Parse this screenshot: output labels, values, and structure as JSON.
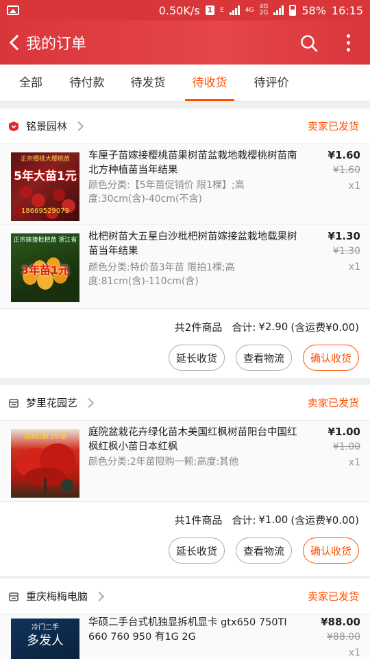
{
  "status_bar": {
    "speed": "0.50K/s",
    "sim": "1",
    "network_a": "E",
    "network_b": "4G",
    "network_c_top": "4G",
    "network_c_bottom": "2G",
    "battery": "58%",
    "time": "16:15"
  },
  "header": {
    "title": "我的订单"
  },
  "tabs": [
    {
      "label": "全部",
      "active": false
    },
    {
      "label": "待付款",
      "active": false
    },
    {
      "label": "待发货",
      "active": false
    },
    {
      "label": "待收货",
      "active": true
    },
    {
      "label": "待评价",
      "active": false
    }
  ],
  "orders": [
    {
      "shop": "铭景园林",
      "status": "卖家已发货",
      "items": [
        {
          "title": "车厘子苗嫁接樱桃苗果树苗盆栽地栽樱桃树苗南北方种植苗当年结果",
          "spec": "颜色分类:【5年苗促销价 限1棵】;高度:30cm(含)-40cm(不含)",
          "price": "¥1.60",
          "original_price": "¥1.60",
          "qty": "x1",
          "thumb_text_top": "正宗樱桃大樱桃苗",
          "thumb_text_mid": "5年大苗1元",
          "thumb_text_bottom": "18669529079"
        },
        {
          "title": "枇杷树苗大五星白沙枇杷树苗嫁接盆栽地载果树苗当年结果",
          "spec": "颜色分类:特价苗3年苗 限拍1棵;高度:81cm(含)-110cm(含)",
          "price": "¥1.30",
          "original_price": "¥1.30",
          "qty": "x1",
          "thumb_text_top": "正宗嫁接枇杷苗 浙江省",
          "thumb_text_mid": "3年苗1元"
        }
      ],
      "summary_count": "共2件商品",
      "summary_total_label": "合计:",
      "summary_total": "¥2.90",
      "summary_shipping": "(含运费¥0.00)",
      "buttons": [
        "延长收货",
        "查看物流",
        "确认收货"
      ]
    },
    {
      "shop": "梦里花园艺",
      "status": "卖家已发货",
      "items": [
        {
          "title": "庭院盆栽花卉绿化苗木美国红枫树苗阳台中国红枫红枫小苗日本红枫",
          "spec": "颜色分类:2年苗限购一颗;高度:其他",
          "price": "¥1.00",
          "original_price": "¥1.00",
          "qty": "x1",
          "thumb_text_top": "日本红枫 2年苗"
        }
      ],
      "summary_count": "共1件商品",
      "summary_total_label": "合计:",
      "summary_total": "¥1.00",
      "summary_shipping": "(含运费¥0.00)",
      "buttons": [
        "延长收货",
        "查看物流",
        "确认收货"
      ]
    },
    {
      "shop": "重庆梅梅电脑",
      "status": "卖家已发货",
      "items": [
        {
          "title": "华硕二手台式机独显拆机显卡 gtx650 750TI 660 760 950 有1G 2G",
          "price": "¥88.00",
          "original_price": "¥88.00",
          "qty": "x1",
          "thumb_text_top": "冷门二手",
          "thumb_text_mid": "多发人"
        }
      ]
    }
  ],
  "colors": {
    "brand_red": "#d9363a",
    "accent_orange": "#ff5000"
  }
}
